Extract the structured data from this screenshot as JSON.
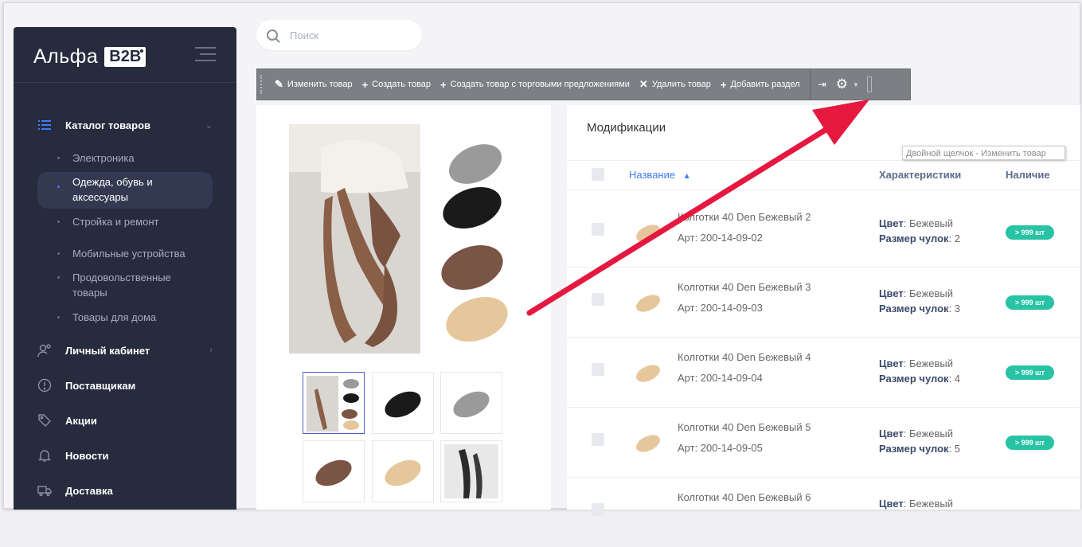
{
  "brand": {
    "name": "Альфа",
    "badge": "B2B"
  },
  "search": {
    "placeholder": "Поиск"
  },
  "sidebar": {
    "catalog": {
      "label": "Каталог товаров"
    },
    "subitems": [
      {
        "label": "Электроника"
      },
      {
        "label": "Одежда, обувь и аксессуары"
      },
      {
        "label": "Стройка и ремонт"
      },
      {
        "label": "Мобильные устройства"
      },
      {
        "label": "Продовольственные товары"
      },
      {
        "label": "Товары для дома"
      }
    ],
    "items": [
      {
        "label": "Личный кабинет"
      },
      {
        "label": "Поставщикам"
      },
      {
        "label": "Акции"
      },
      {
        "label": "Новости"
      },
      {
        "label": "Доставка"
      }
    ]
  },
  "toolbar": {
    "edit": "Изменить товар",
    "create": "Создать товар",
    "create_offers": "Создать товар с торговыми предложениями",
    "delete": "Удалить товар",
    "add_section": "Добавить раздел"
  },
  "tooltip": "Двойной щелчок - Изменить товар",
  "mods": {
    "title": "Модификации",
    "col_name": "Название",
    "col_props": "Характеристики",
    "col_stock": "Наличие",
    "rows": [
      {
        "name": "Колготки 40 Den Бежевый 2",
        "art": "Арт: 200-14-09-02",
        "color_label": "Цвет",
        "color": ": Бежевый",
        "size_label": "Размер чулок",
        "size": ": 2",
        "stock": "> 999 шт"
      },
      {
        "name": "Колготки 40 Den Бежевый 3",
        "art": "Арт: 200-14-09-03",
        "color_label": "Цвет",
        "color": ": Бежевый",
        "size_label": "Размер чулок",
        "size": ": 3",
        "stock": "> 999 шт"
      },
      {
        "name": "Колготки 40 Den Бежевый 4",
        "art": "Арт: 200-14-09-04",
        "color_label": "Цвет",
        "color": ": Бежевый",
        "size_label": "Размер чулок",
        "size": ": 4",
        "stock": "> 999 шт"
      },
      {
        "name": "Колготки 40 Den Бежевый 5",
        "art": "Арт: 200-14-09-05",
        "color_label": "Цвет",
        "color": ": Бежевый",
        "size_label": "Размер чулок",
        "size": ": 5",
        "stock": "> 999 шт"
      },
      {
        "name": "Колготки 40 Den Бежевый 6",
        "art": "",
        "color_label": "Цвет",
        "color": ": Бежевый",
        "size_label": "",
        "size": "",
        "stock": ""
      }
    ]
  },
  "colors": {
    "sidebar": "#262b3d",
    "accent": "#3d7cf4",
    "stock": "#27c3a4",
    "arrow": "#e5183f"
  }
}
